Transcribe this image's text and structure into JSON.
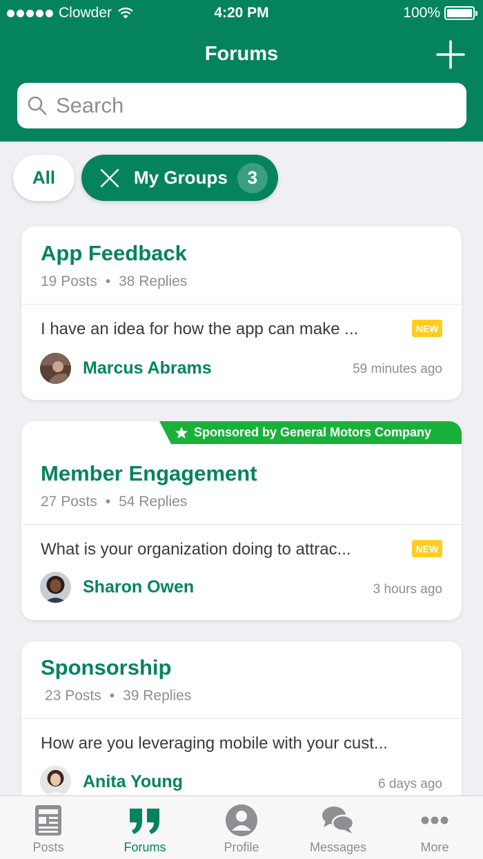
{
  "status_bar": {
    "carrier": "Clowder",
    "time": "4:20 PM",
    "battery": "100%"
  },
  "nav": {
    "title": "Forums"
  },
  "search": {
    "placeholder": "Search"
  },
  "filters": {
    "all_label": "All",
    "groups_label": "My Groups",
    "groups_count": "3"
  },
  "forums": [
    {
      "title": "App Feedback",
      "posts": "19 Posts",
      "replies": "38 Replies",
      "preview": "I have an idea for how the app can make ...",
      "badge": "NEW",
      "author": "Marcus Abrams",
      "time": "59 minutes ago"
    },
    {
      "sponsor": "Sponsored by General Motors Company",
      "title": "Member Engagement",
      "posts": "27 Posts",
      "replies": "54 Replies",
      "preview": "What is your organization doing to attrac...",
      "badge": "NEW",
      "author": "Sharon Owen",
      "time": "3 hours ago"
    },
    {
      "title": "Sponsorship",
      "posts": "23 Posts",
      "replies": "39 Replies",
      "preview": "How are you leveraging mobile with your cust...",
      "author": "Anita Young",
      "time": "6 days ago"
    }
  ],
  "separator": "•",
  "tabbar": {
    "active": "Forums",
    "tabs": [
      {
        "label": "Posts",
        "icon": "posts-icon"
      },
      {
        "label": "Forums",
        "icon": "quote-icon"
      },
      {
        "label": "Profile",
        "icon": "profile-icon"
      },
      {
        "label": "Messages",
        "icon": "messages-icon"
      },
      {
        "label": "More",
        "icon": "more-icon"
      }
    ]
  },
  "colors": {
    "brand": "#05835f",
    "sponsor": "#19b13a",
    "new_badge": "#ffcc1f",
    "background": "#efeff4"
  }
}
